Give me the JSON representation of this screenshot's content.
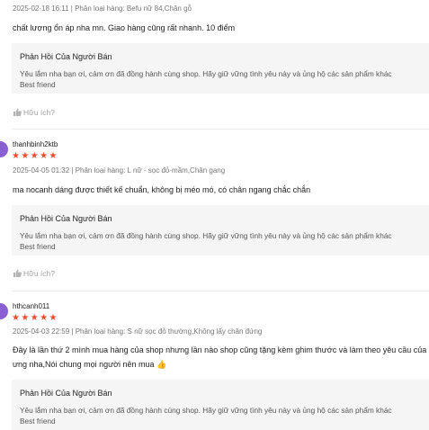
{
  "reviews": [
    {
      "username": "",
      "stars": "",
      "meta": "2025-02-18 16:11 | Phân loại hàng: Befu nữ 84,Chân gỗ",
      "content_lines": [
        "chất lượng ổn áp nha mn. Giao hàng cũng rất nhanh. 10 điểm"
      ],
      "reply_title": "Phản Hồi Của Người Bán",
      "reply_lines": [
        "Yêu lắm nha bạn ơi, cảm ơn đã đồng hành cùng shop. Hãy giữ vững tình yêu này và ủng hộ các sản phẩm khác",
        "Best friend"
      ],
      "helpful": "Hữu ích?"
    },
    {
      "username": "thanhbinh2ktb",
      "stars": "★★★★★",
      "meta": "2025-04-05 01:32 | Phân loại hàng: L nữ - sọc đỏ-mầm,Chân gang",
      "content_lines": [
        "ma nocanh dáng được thiết kế chuẩn, không bị méo mó,  có chân ngang chắc chắn"
      ],
      "reply_title": "Phản Hồi Của Người Bán",
      "reply_lines": [
        "Yêu lắm nha bạn ơi, cảm ơn đã đồng hành cùng shop. Hãy giữ vững tình yêu này và ủng hộ các sản phẩm khác",
        "Best friend"
      ],
      "helpful": "Hữu ích?"
    },
    {
      "username": "hthcanh011",
      "stars": "★★★★★",
      "meta": "2025-04-03 22:59 | Phân loại hàng: S nữ sọc đỏ thường,Không lấy chân đứng",
      "content_lines": [
        "Đây là lần thứ 2 mình mua hàng của shop nhưng lần nào shop cũng tặng kèm ghim thước và làm theo yêu cầu của",
        "ưng nha,Nói chung mọi người nên mua"
      ],
      "content_emoji": "👍",
      "reply_title": "Phản Hồi Của Người Bán",
      "reply_lines": [
        "Yêu lắm nha bạn ơi, cảm ơn đã đồng hành cùng shop. Hãy giữ vững tình yêu này và ủng hộ các sản phẩm khác",
        "Best friend"
      ]
    }
  ],
  "colors": {
    "star": "#ee4d2d",
    "avatar": "#8a5fd1",
    "reply_bg": "#f5f5f5"
  },
  "icons": {
    "helpful": "thumbs-up-icon"
  }
}
